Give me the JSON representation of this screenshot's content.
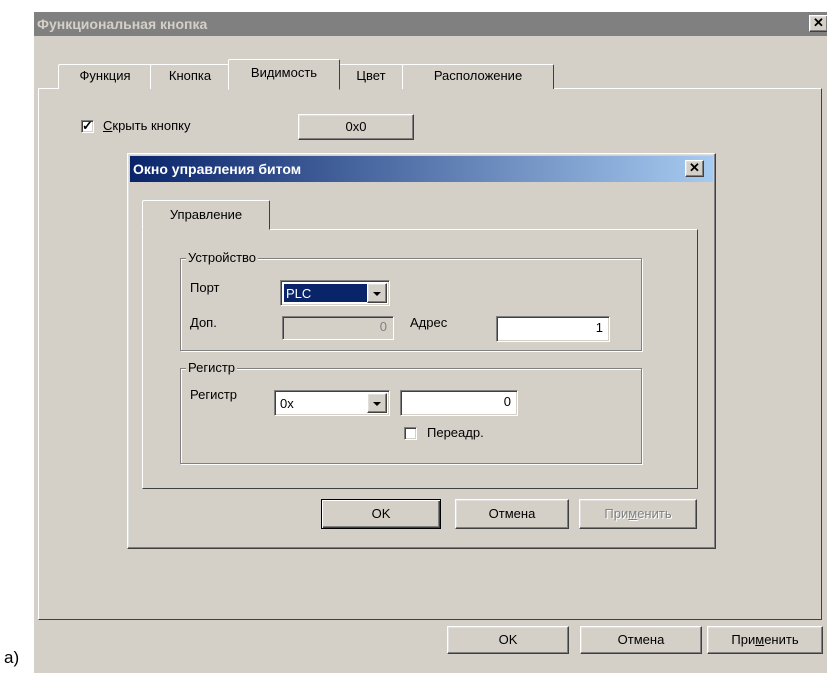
{
  "outer_dialog": {
    "title": "Функциональная кнопка",
    "close": "✕",
    "tabs": [
      {
        "label": "Функция"
      },
      {
        "label": "Кнопка"
      },
      {
        "label": "Видимость",
        "active": true
      },
      {
        "label": "Цвет"
      },
      {
        "label": "Расположение"
      }
    ],
    "hide_button_checkbox": {
      "accel": "С",
      "label_rest": "крыть кнопку",
      "checked": true,
      "check_glyph": "✓"
    },
    "address_button_label": "0x0",
    "ok_label": "OK",
    "cancel_label": "Отмена",
    "apply_label_pre": "При",
    "apply_label_accel": "м",
    "apply_label_post": "енить"
  },
  "inner_dialog": {
    "title": "Окно управления битом",
    "close": "✕",
    "tab_label": "Управление",
    "device_group": {
      "label": "Устройство",
      "port_label": "Порт",
      "port_value": "PLC",
      "extra_label": "Доп.",
      "extra_value": "0",
      "address_label": "Адрес",
      "address_value": "1"
    },
    "register_group": {
      "label": "Регистр",
      "register_label": "Регистр",
      "register_value": "0x",
      "register_number": "0",
      "readdress_label": "Переадр.",
      "readdress_checked": false
    },
    "ok_label": "OK",
    "cancel_label": "Отмена",
    "apply_label_pre": "При",
    "apply_label_accel": "м",
    "apply_label_post": "енить",
    "apply_disabled": true
  },
  "figure_label": "а)",
  "colors": {
    "face": "#d4d0c8",
    "outer_title": "#808080",
    "inner_title_start": "#0a246a",
    "inner_title_end": "#a6caf0"
  }
}
